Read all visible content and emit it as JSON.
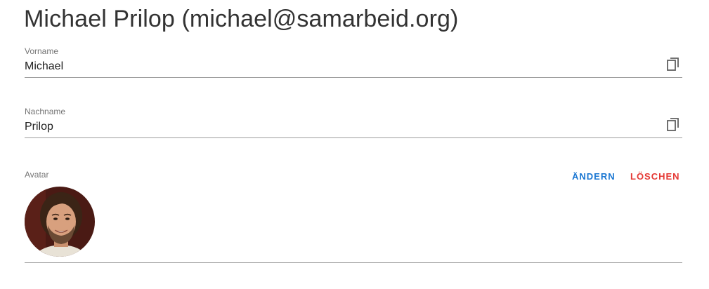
{
  "header": {
    "title": "Michael Prilop (michael@samarbeid.org)"
  },
  "fields": {
    "vorname": {
      "label": "Vorname",
      "value": "Michael",
      "copy_icon": "content-copy-icon"
    },
    "nachname": {
      "label": "Nachname",
      "value": "Prilop",
      "copy_icon": "content-copy-icon"
    }
  },
  "avatar": {
    "label": "Avatar",
    "change_label": "ÄNDERN",
    "delete_label": "LÖSCHEN",
    "image_alt": "profile photo"
  },
  "colors": {
    "primary": "#1976d2",
    "danger": "#e53935",
    "text": "#212121",
    "label": "#757575",
    "divider": "#9e9e9e"
  }
}
